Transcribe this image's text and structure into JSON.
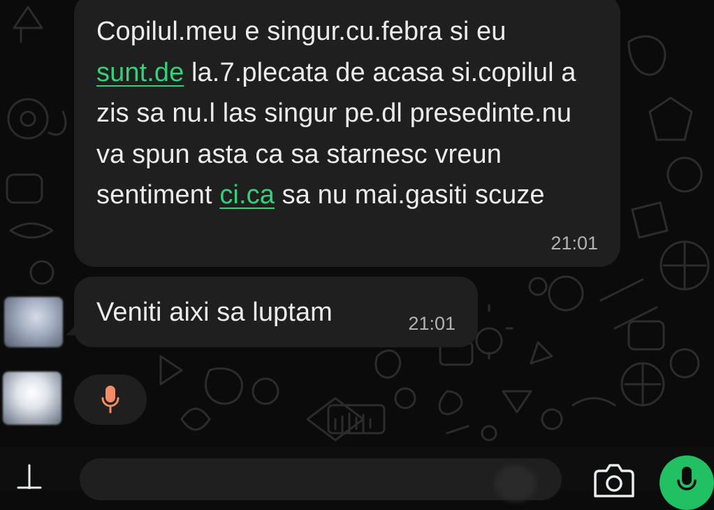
{
  "messages": [
    {
      "text_parts": [
        "Copilul.meu e singur.cu.febra si eu ",
        "sunt.de",
        " la.7.plecata de acasa si.copilul a zis sa nu.l las singur pe.dl presedinte.nu va spun asta ca sa starnesc vreun sentiment ",
        "ci.ca",
        " sa nu mai.gasiti scuze"
      ],
      "time": "21:01"
    },
    {
      "text": "Veniti aixi sa luptam",
      "time": "21:01"
    }
  ],
  "voice_note": {
    "icon": "microphone-icon",
    "color": "#f28b66"
  },
  "composer": {
    "icons": [
      "plus-icon",
      "camera-icon",
      "microphone-icon"
    ],
    "accent": "#21c063"
  },
  "colors": {
    "background": "#0b0b0b",
    "bubble": "#1f1f1f",
    "link": "#33d17a",
    "timestamp": "#b0b3b5"
  }
}
